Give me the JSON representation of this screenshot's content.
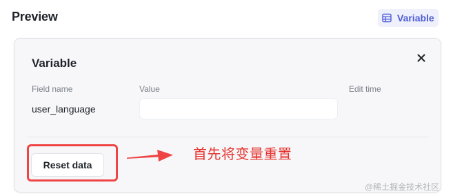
{
  "header": {
    "title": "Preview",
    "variable_toggle": {
      "label": "Variable",
      "icon": "table-icon",
      "accent_color": "#4e5bd6"
    }
  },
  "panel": {
    "title": "Variable",
    "close_icon": "close-icon",
    "columns": [
      "Field name",
      "Value",
      "Edit time"
    ],
    "rows": [
      {
        "field_name": "user_language",
        "value": "",
        "edit_time": ""
      }
    ],
    "reset_button_label": "Reset data"
  },
  "annotation": {
    "text": "首先将变量重置",
    "color": "#e5322d"
  },
  "watermark": "@稀土掘金技术社区"
}
